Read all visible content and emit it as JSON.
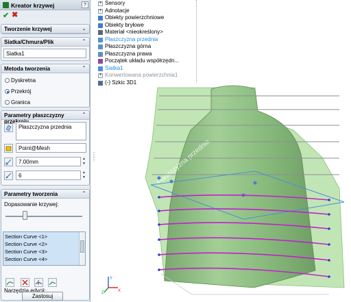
{
  "panel": {
    "title": "Kreator krzywej",
    "help": "?",
    "groups": {
      "creation": {
        "title": "Tworzenie krzywej"
      },
      "mesh": {
        "title": "Siatka/Chmura/Plik",
        "value": "Siatka1"
      },
      "method": {
        "title": "Metoda tworzenia",
        "options": [
          "Dyskretna",
          "Przekrój",
          "Granica"
        ],
        "selected": "Przekrój"
      },
      "plane_params": {
        "title": "Parametry płaszczyzny przekroju",
        "plane": "Płaszczyzna przednia",
        "point": "Point@Mesh",
        "spacing": "7.00mm",
        "count": "6"
      },
      "creation_params": {
        "title": "Parametry tworzenia",
        "fit_label": "Dopasowanie krzywej:",
        "fit_level": 0.25,
        "curves": [
          "Section Curve <1>",
          "Section Curve <2>",
          "Section Curve <3>",
          "Section Curve <4>"
        ],
        "tools_label": "Narzędzia edycji:",
        "apply": "Zastosuj"
      }
    }
  },
  "tree": [
    {
      "label": "Sensory",
      "icon": "sensor-icon",
      "expand": true
    },
    {
      "label": "Adnotacje",
      "icon": "annotation-icon",
      "expand": true
    },
    {
      "label": "Obiekty powierzchniowe",
      "icon": "surface-bodies-icon",
      "expand": false
    },
    {
      "label": "Obiekty bryłowe",
      "icon": "solid-bodies-icon",
      "expand": false
    },
    {
      "label": "Materiał <nieokreślony>",
      "icon": "material-icon",
      "expand": false
    },
    {
      "label": "Płaszczyzna przednia",
      "icon": "plane-icon",
      "expand": false,
      "style": "blue"
    },
    {
      "label": "Płaszczyzna górna",
      "icon": "plane-icon",
      "expand": false
    },
    {
      "label": "Płaszczyzna prawa",
      "icon": "plane-icon",
      "expand": false
    },
    {
      "label": "Początek układu współrzędn...",
      "icon": "origin-icon",
      "expand": false
    },
    {
      "label": "Siatka1",
      "icon": "mesh-icon",
      "expand": false,
      "style": "blue"
    },
    {
      "label": "Konwertowana powierzchnia1",
      "icon": "surface-icon",
      "expand": true,
      "style": "grey"
    },
    {
      "label": "(-) Szkic 3D1",
      "icon": "sketch-3d-icon",
      "expand": false
    }
  ],
  "viewport": {
    "plane_label": "Płaszczyzna przednia",
    "colors": {
      "plane": "#9ed38f",
      "mesh": "#8fbf82",
      "section_curve": "#c21fd0",
      "curve_point": "#2b3ec8",
      "sketch_line": "#4a90d9"
    }
  }
}
